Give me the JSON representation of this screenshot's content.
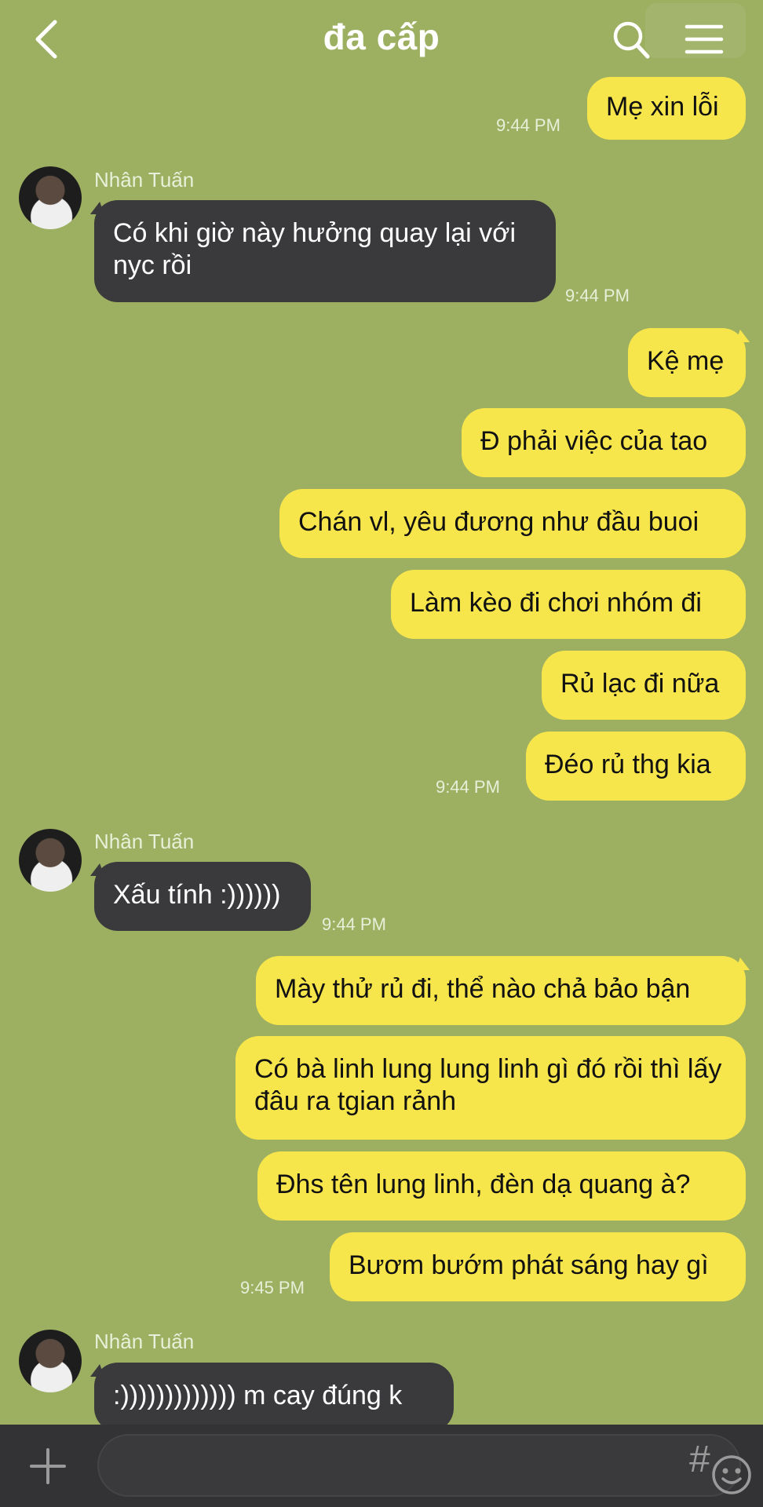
{
  "header": {
    "title": "đa cấp"
  },
  "messages": {
    "m0": "Mẹ xin lỗi",
    "t0": "9:44 PM",
    "s1": "Nhân Tuấn",
    "m1": "Có khi giờ này hưởng quay lại với nyc rồi",
    "t1": "9:44 PM",
    "m2": "Kệ mẹ",
    "m3": "Đ phải việc của tao",
    "m4": "Chán vl, yêu đương như đầu buoi",
    "m5": "Làm kèo đi chơi nhóm đi",
    "m6": "Rủ lạc đi nữa",
    "m7": "Đéo rủ thg kia",
    "t7": "9:44 PM",
    "s8": "Nhân Tuấn",
    "m8": "Xấu tính :))))))",
    "t8": "9:44 PM",
    "m9": "Mày thử rủ đi, thể nào chả bảo bận",
    "m10": "Có bà linh lung lung linh gì đó rồi thì lấy đâu ra tgian rảnh",
    "m11": "Đhs tên lung linh, đèn dạ quang à?",
    "m12": "Bươm bướm phát sáng hay gì",
    "t12": "9:45 PM",
    "s13": "Nhân Tuấn",
    "m13": ":))))))))))))) m cay đúng k"
  },
  "composer": {
    "hash_label": "#"
  },
  "icons": {
    "back": "chevron-left-icon",
    "search": "search-icon",
    "menu": "menu-icon",
    "plus": "plus-icon",
    "emoji": "emoji-icon"
  },
  "colors": {
    "background": "#9db062",
    "outgoing_bubble": "#f7e64b",
    "incoming_bubble": "#3a3a3c",
    "bottom_bar": "#333335"
  }
}
